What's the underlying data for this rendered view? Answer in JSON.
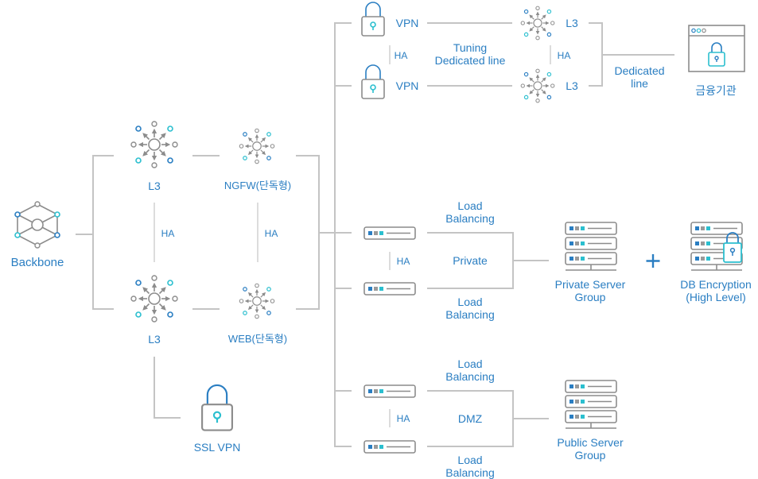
{
  "diagram": {
    "colors": {
      "text": "#2a7ec2",
      "line": "#c4c4c4",
      "icon_gray": "#8c8c8c",
      "accent_blue": "#2a7ec2",
      "accent_teal": "#2bbfcf"
    },
    "left": {
      "backbone": {
        "label": "Backbone",
        "icon": "backbone-hexagon-icon"
      },
      "l3_top": {
        "label": "L3",
        "icon": "l3-switch-icon"
      },
      "l3_bottom": {
        "label": "L3",
        "icon": "l3-switch-icon"
      },
      "ngfw": {
        "label": "NGFW(단독형)",
        "icon": "firewall-hub-icon"
      },
      "web": {
        "label": "WEB(단독형)",
        "icon": "web-hub-icon"
      },
      "ha_l3": "HA",
      "ha_fw": "HA",
      "ssl_vpn": {
        "label": "SSL VPN",
        "icon": "lock-icon"
      }
    },
    "top": {
      "vpn_1": "VPN",
      "vpn_2": "VPN",
      "ha_vpn": "HA",
      "tuning_label": "Tuning\nDedicated line",
      "l3_1": "L3",
      "l3_2": "L3",
      "ha_l3": "HA",
      "dedicated_label": "Dedicated\nline",
      "financial_institution": "금융기관"
    },
    "private": {
      "lb_top": "Load\nBalancing",
      "lb_bottom": "Load\nBalancing",
      "ha": "HA",
      "zone": "Private",
      "server_group": "Private Server\nGroup",
      "plus": "+",
      "db_encryption": "DB Encryption\n(High Level)"
    },
    "dmz": {
      "lb_top": "Load\nBalancing",
      "lb_bottom": "Load\nBalancing",
      "ha": "HA",
      "zone": "DMZ",
      "server_group": "Public Server\nGroup"
    }
  }
}
